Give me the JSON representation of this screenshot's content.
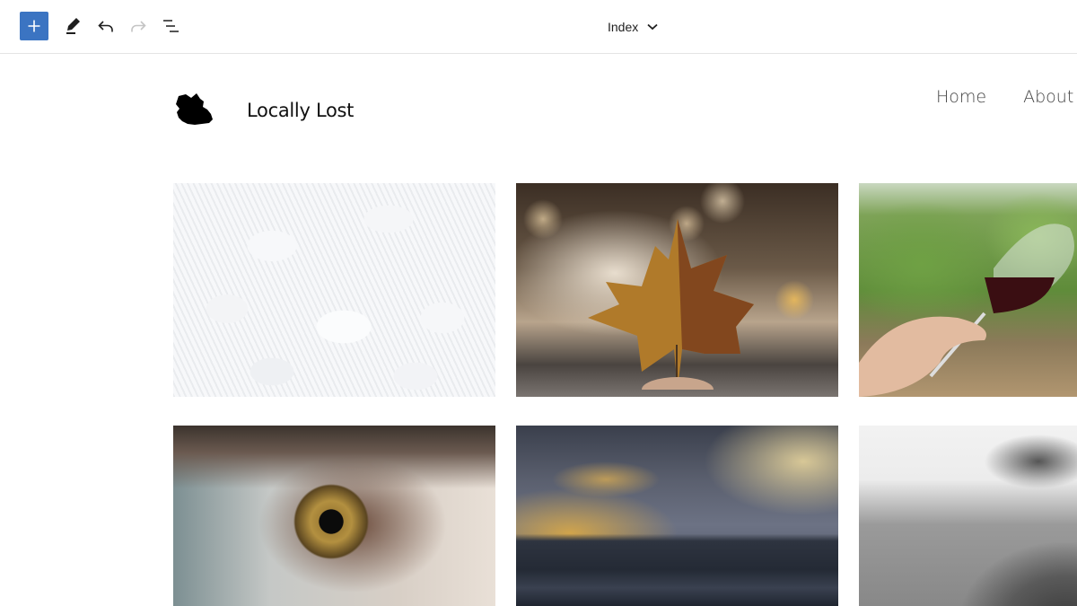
{
  "toolbar": {
    "add_block_label": "Add block",
    "tools_label": "Tools",
    "undo_label": "Undo",
    "redo_label": "Redo",
    "list_view_label": "List view",
    "icons": [
      "plus-icon",
      "pencil-icon",
      "undo-icon",
      "redo-icon",
      "list-view-icon",
      "chevron-down-icon"
    ],
    "accent_color": "#3b74c2"
  },
  "document": {
    "title": "Index"
  },
  "site": {
    "title": "Locally Lost",
    "nav": [
      {
        "label": "Home"
      },
      {
        "label": "About"
      }
    ]
  },
  "gallery": {
    "images": [
      {
        "subject": "white seashells"
      },
      {
        "subject": "autumn maple leaf held in hand"
      },
      {
        "subject": "hand holding glass of red wine in vineyard"
      },
      {
        "subject": "close-up of hazel eye"
      },
      {
        "subject": "sunset clouds over hills with wind turbines"
      },
      {
        "subject": "black and white weathered surface"
      }
    ]
  }
}
